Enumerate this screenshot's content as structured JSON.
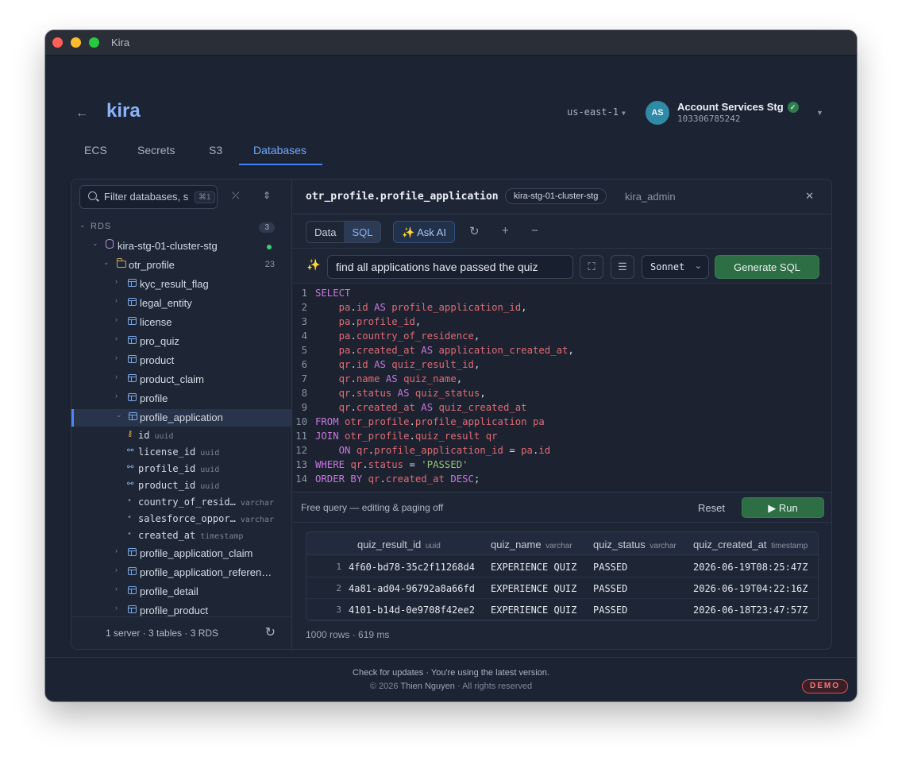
{
  "window": {
    "title": "Kira"
  },
  "header": {
    "app_name": "kira",
    "region": "us-east-1",
    "account": {
      "initials": "AS",
      "name": "Account Services Stg",
      "id": "103306785242"
    }
  },
  "tabs": [
    {
      "label": "ECS"
    },
    {
      "label": "Secrets"
    },
    {
      "label": "S3"
    },
    {
      "label": "Databases",
      "active": true
    }
  ],
  "sidebar": {
    "filter_placeholder": "Filter databases, s",
    "filter_shortcut": "⌘1",
    "group": {
      "label": "RDS",
      "count": "3"
    },
    "cluster": "kira-stg-01-cluster-stg",
    "schema": {
      "label": "otr_profile",
      "count": "23"
    },
    "tables_before": [
      "kyc_result_flag",
      "legal_entity",
      "license",
      "pro_quiz",
      "product",
      "product_claim",
      "profile"
    ],
    "selected_table": "profile_application",
    "columns": [
      {
        "name": "id",
        "type": "uuid",
        "icon": "key-icon"
      },
      {
        "name": "license_id",
        "type": "uuid",
        "icon": "link-icon"
      },
      {
        "name": "profile_id",
        "type": "uuid",
        "icon": "link-icon"
      },
      {
        "name": "product_id",
        "type": "uuid",
        "icon": "link-icon"
      },
      {
        "name": "country_of_resid…",
        "type": "varchar",
        "icon": "dot-icon"
      },
      {
        "name": "salesforce_oppor…",
        "type": "varchar",
        "icon": "dot-icon"
      },
      {
        "name": "created_at",
        "type": "timestamp",
        "icon": "dot-icon"
      }
    ],
    "tables_after": [
      "profile_application_claim",
      "profile_application_referen…",
      "profile_detail",
      "profile_product"
    ],
    "footer": "1 server · 3 tables · 3 RDS"
  },
  "main": {
    "title": "otr_profile.profile_application",
    "cluster": "kira-stg-01-cluster-stg",
    "user": "kira_admin",
    "modes": [
      "Data",
      "SQL"
    ],
    "ask_ai": "✨ Ask AI",
    "prompt": "find all applications have passed the quiz",
    "model": "Sonnet",
    "generate_label": "Generate SQL",
    "sql_lines": [
      [
        [
          "kw",
          "SELECT"
        ]
      ],
      [
        [
          "t",
          "    "
        ],
        [
          "id",
          "pa"
        ],
        [
          "op",
          "."
        ],
        [
          "id",
          "id"
        ],
        [
          "t",
          " "
        ],
        [
          "kw",
          "AS"
        ],
        [
          "t",
          " "
        ],
        [
          "id",
          "profile_application_id"
        ],
        [
          "op",
          ","
        ]
      ],
      [
        [
          "t",
          "    "
        ],
        [
          "id",
          "pa"
        ],
        [
          "op",
          "."
        ],
        [
          "id",
          "profile_id"
        ],
        [
          "op",
          ","
        ]
      ],
      [
        [
          "t",
          "    "
        ],
        [
          "id",
          "pa"
        ],
        [
          "op",
          "."
        ],
        [
          "id",
          "country_of_residence"
        ],
        [
          "op",
          ","
        ]
      ],
      [
        [
          "t",
          "    "
        ],
        [
          "id",
          "pa"
        ],
        [
          "op",
          "."
        ],
        [
          "id",
          "created_at"
        ],
        [
          "t",
          " "
        ],
        [
          "kw",
          "AS"
        ],
        [
          "t",
          " "
        ],
        [
          "id",
          "application_created_at"
        ],
        [
          "op",
          ","
        ]
      ],
      [
        [
          "t",
          "    "
        ],
        [
          "id",
          "qr"
        ],
        [
          "op",
          "."
        ],
        [
          "id",
          "id"
        ],
        [
          "t",
          " "
        ],
        [
          "kw",
          "AS"
        ],
        [
          "t",
          " "
        ],
        [
          "id",
          "quiz_result_id"
        ],
        [
          "op",
          ","
        ]
      ],
      [
        [
          "t",
          "    "
        ],
        [
          "id",
          "qr"
        ],
        [
          "op",
          "."
        ],
        [
          "id",
          "name"
        ],
        [
          "t",
          " "
        ],
        [
          "kw",
          "AS"
        ],
        [
          "t",
          " "
        ],
        [
          "id",
          "quiz_name"
        ],
        [
          "op",
          ","
        ]
      ],
      [
        [
          "t",
          "    "
        ],
        [
          "id",
          "qr"
        ],
        [
          "op",
          "."
        ],
        [
          "id",
          "status"
        ],
        [
          "t",
          " "
        ],
        [
          "kw",
          "AS"
        ],
        [
          "t",
          " "
        ],
        [
          "id",
          "quiz_status"
        ],
        [
          "op",
          ","
        ]
      ],
      [
        [
          "t",
          "    "
        ],
        [
          "id",
          "qr"
        ],
        [
          "op",
          "."
        ],
        [
          "id",
          "created_at"
        ],
        [
          "t",
          " "
        ],
        [
          "kw",
          "AS"
        ],
        [
          "t",
          " "
        ],
        [
          "id",
          "quiz_created_at"
        ]
      ],
      [
        [
          "kw",
          "FROM"
        ],
        [
          "t",
          " "
        ],
        [
          "id",
          "otr_profile"
        ],
        [
          "op",
          "."
        ],
        [
          "id",
          "profile_application"
        ],
        [
          "t",
          " "
        ],
        [
          "id",
          "pa"
        ]
      ],
      [
        [
          "kw",
          "JOIN"
        ],
        [
          "t",
          " "
        ],
        [
          "id",
          "otr_profile"
        ],
        [
          "op",
          "."
        ],
        [
          "id",
          "quiz_result"
        ],
        [
          "t",
          " "
        ],
        [
          "id",
          "qr"
        ]
      ],
      [
        [
          "t",
          "    "
        ],
        [
          "kw",
          "ON"
        ],
        [
          "t",
          " "
        ],
        [
          "id",
          "qr"
        ],
        [
          "op",
          "."
        ],
        [
          "id",
          "profile_application_id"
        ],
        [
          "t",
          " "
        ],
        [
          "op",
          "="
        ],
        [
          "t",
          " "
        ],
        [
          "id",
          "pa"
        ],
        [
          "op",
          "."
        ],
        [
          "id",
          "id"
        ]
      ],
      [
        [
          "kw",
          "WHERE"
        ],
        [
          "t",
          " "
        ],
        [
          "id",
          "qr"
        ],
        [
          "op",
          "."
        ],
        [
          "id",
          "status"
        ],
        [
          "t",
          " "
        ],
        [
          "op",
          "="
        ],
        [
          "t",
          " "
        ],
        [
          "str",
          "'PASSED'"
        ]
      ],
      [
        [
          "kw",
          "ORDER BY"
        ],
        [
          "t",
          " "
        ],
        [
          "id",
          "qr"
        ],
        [
          "op",
          "."
        ],
        [
          "id",
          "created_at"
        ],
        [
          "t",
          " "
        ],
        [
          "kw",
          "DESC"
        ],
        [
          "op",
          ";"
        ]
      ]
    ],
    "exec_hint": "Free query — editing & paging off",
    "reset_label": "Reset",
    "run_label": "▶ Run",
    "results": {
      "columns": [
        {
          "name": "quiz_result_id",
          "type": "uuid"
        },
        {
          "name": "quiz_name",
          "type": "varchar"
        },
        {
          "name": "quiz_status",
          "type": "varchar"
        },
        {
          "name": "quiz_created_at",
          "type": "timestamp"
        }
      ],
      "rows": [
        [
          "1",
          "4f60-bd78-35c2f11268d4",
          "EXPERIENCE QUIZ",
          "PASSED",
          "2026-06-19T08:25:47Z"
        ],
        [
          "2",
          "4a81-ad04-96792a8a66fd",
          "EXPERIENCE QUIZ",
          "PASSED",
          "2026-06-19T04:22:16Z"
        ],
        [
          "3",
          "4101-b14d-0e9708f42ee2",
          "EXPERIENCE QUIZ",
          "PASSED",
          "2026-06-18T23:47:57Z"
        ]
      ],
      "meta": "1000 rows · 619 ms"
    }
  },
  "footer": {
    "check_updates": "Check for updates",
    "separator": "·",
    "status": "You're using the latest version.",
    "copyright_prefix": "© 2026",
    "author": "Thien Nguyen",
    "copyright_suffix": "· All rights reserved",
    "demo_badge": "DEMO"
  }
}
